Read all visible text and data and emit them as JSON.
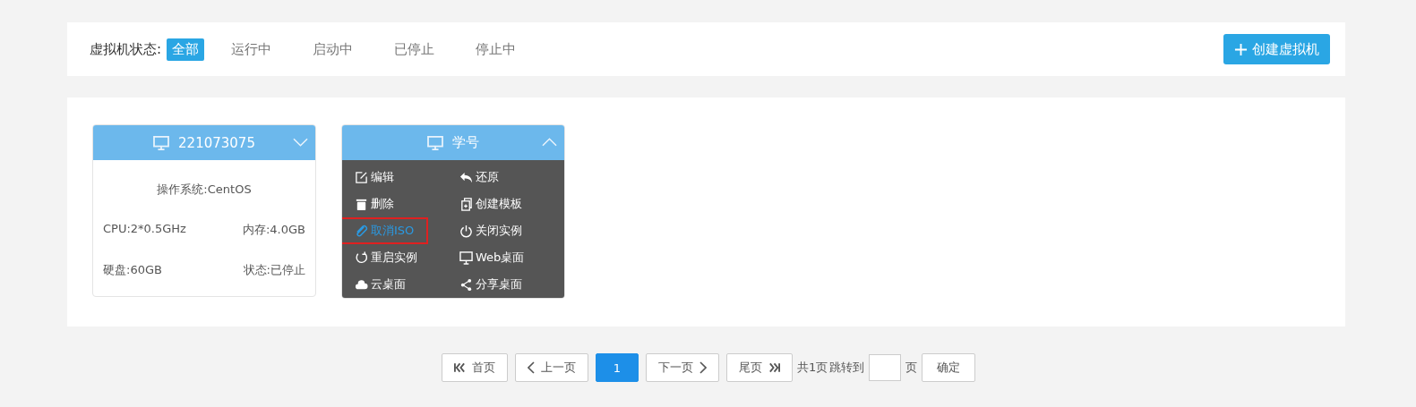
{
  "filter": {
    "label": "虚拟机状态:",
    "options": [
      {
        "label": "全部",
        "selected": true
      },
      {
        "label": "运行中",
        "selected": false
      },
      {
        "label": "启动中",
        "selected": false
      },
      {
        "label": "已停止",
        "selected": false
      },
      {
        "label": "停止中",
        "selected": false
      }
    ],
    "create_button": "创建虚拟机"
  },
  "vms": [
    {
      "name": "221073075",
      "expanded": false,
      "os": "操作系统:CentOS",
      "cpu": "CPU:2*0.5GHz",
      "memory": "内存:4.0GB",
      "disk": "硬盘:60GB",
      "status": "状态:已停止"
    },
    {
      "name": "学号",
      "expanded": true,
      "menu": [
        {
          "label": "编辑",
          "kind": "edit",
          "highlighted": false
        },
        {
          "label": "还原",
          "kind": "undo",
          "highlighted": false
        },
        {
          "label": "删除",
          "kind": "trash",
          "highlighted": false
        },
        {
          "label": "创建模板",
          "kind": "copy",
          "highlighted": false
        },
        {
          "label": "取消ISO",
          "kind": "clip",
          "highlighted": true
        },
        {
          "label": "关闭实例",
          "kind": "power",
          "highlighted": false
        },
        {
          "label": "重启实例",
          "kind": "refresh",
          "highlighted": false
        },
        {
          "label": "Web桌面",
          "kind": "monitor",
          "highlighted": false
        },
        {
          "label": "云桌面",
          "kind": "cloud",
          "highlighted": false
        },
        {
          "label": "分享桌面",
          "kind": "share",
          "highlighted": false
        }
      ]
    }
  ],
  "pagination": {
    "first": "首页",
    "prev": "上一页",
    "current": "1",
    "next": "下一页",
    "last": "尾页",
    "total": "共1页",
    "jump_label": "跳转到",
    "page_unit": "页",
    "confirm": "确定"
  }
}
